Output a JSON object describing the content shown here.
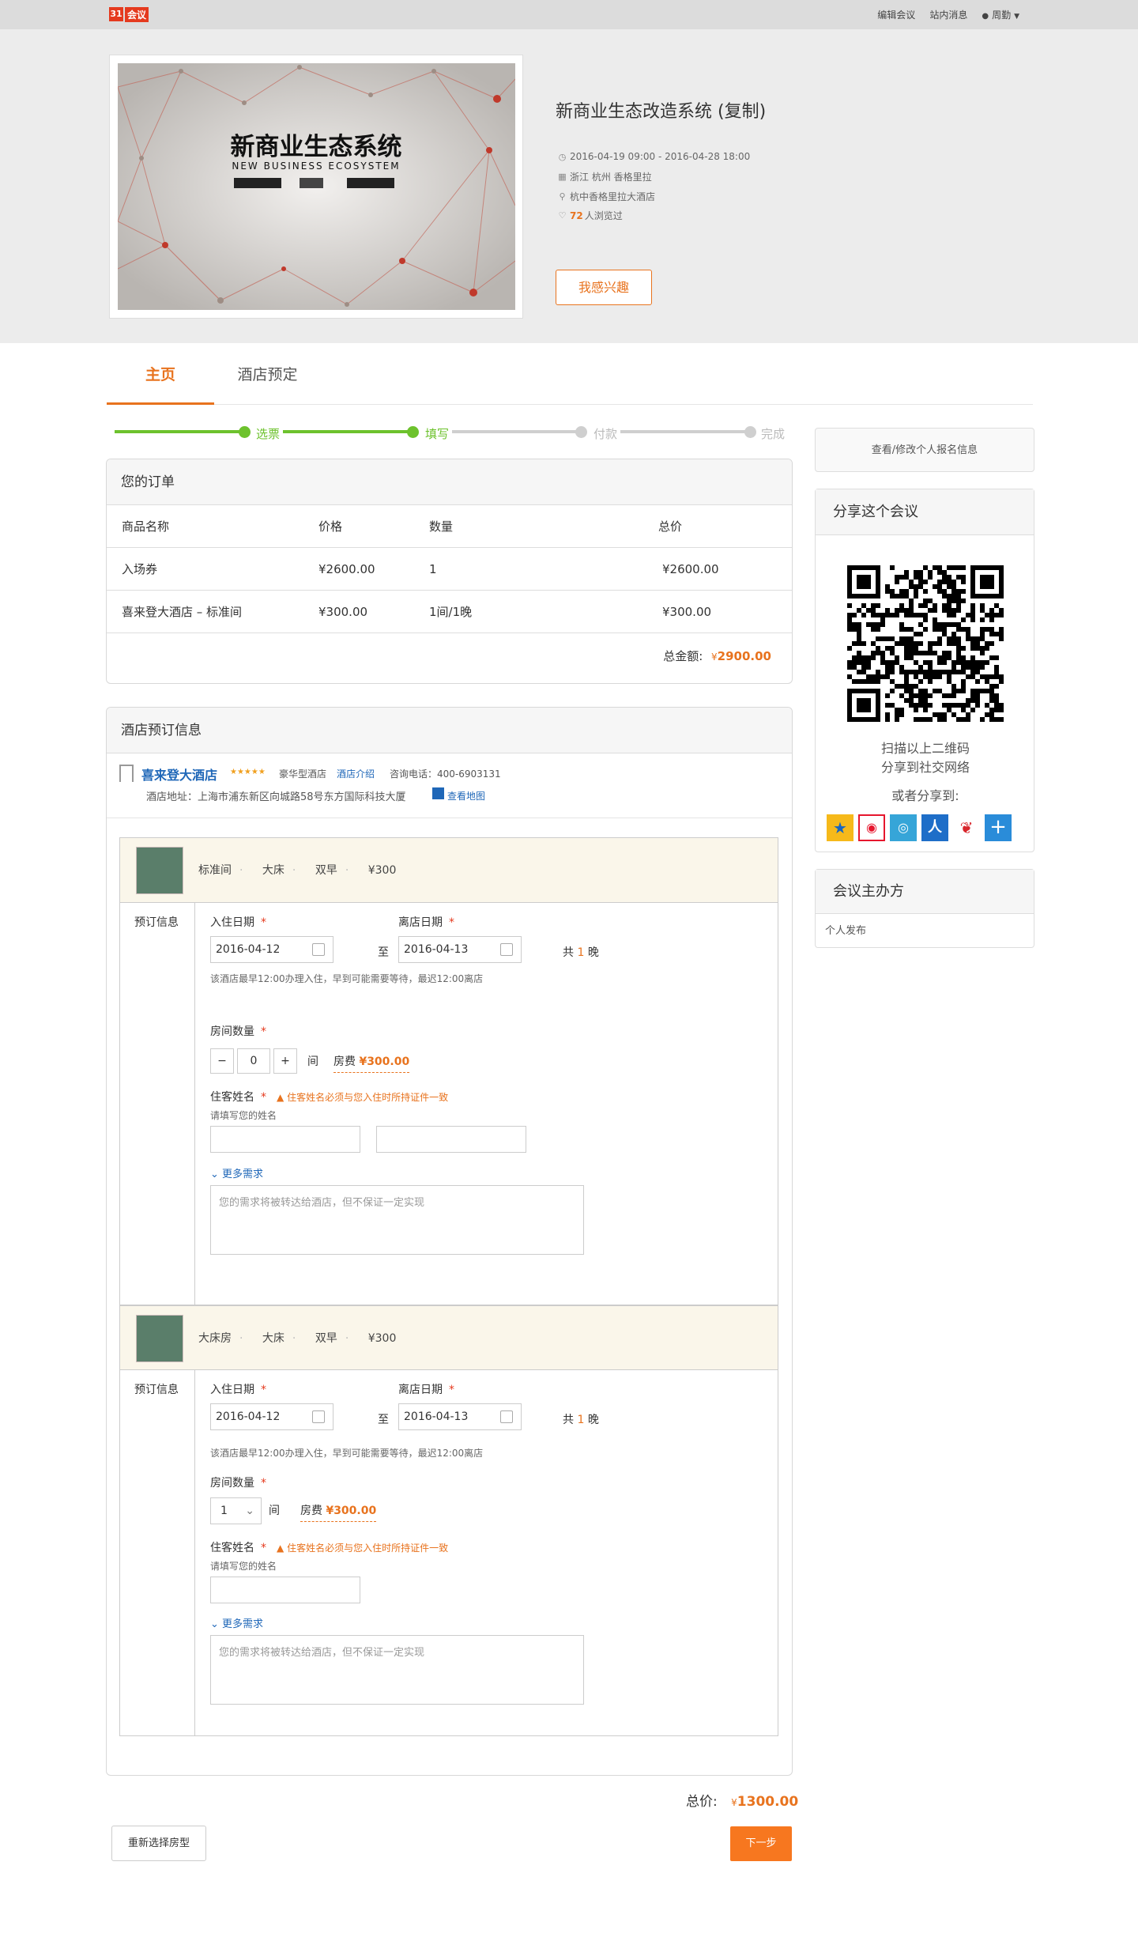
{
  "topbar": {
    "logo_box": "31",
    "logo_text": "会议",
    "nav": [
      "编辑会议",
      "站内消息",
      "周勤"
    ]
  },
  "event": {
    "title": "新商业生态改造系统 (复制)",
    "poster_title": "新商业生态系统",
    "poster_subtitle": "NEW BUSINESS ECOSYSTEM",
    "date": "2016-04-19 09:00 - 2016-04-28 18:00",
    "location": "浙江 杭州 香格里拉",
    "venue": "杭中香格里拉大酒店",
    "views_count": "72",
    "views_suffix": "人浏览过",
    "interest_btn": "我感兴趣"
  },
  "tabs": [
    "主页",
    "酒店预定"
  ],
  "steps": [
    "选票",
    "填写",
    "付款",
    "完成"
  ],
  "colors": {
    "accent": "#e8731e",
    "step_done": "#6dc22d",
    "step_todo": "#cfcfcf"
  },
  "order": {
    "title": "您的订单",
    "headers": [
      "商品名称",
      "价格",
      "数量",
      "总价"
    ],
    "rows": [
      [
        "入场券",
        "¥2600.00",
        "1",
        "¥2600.00"
      ],
      [
        "喜来登大酒店 – 标准间",
        "¥300.00",
        "1间/1晚",
        "¥300.00"
      ]
    ],
    "total_label": "总金额:",
    "total_currency": "¥",
    "total_value": "2900.00"
  },
  "hotel": {
    "title": "酒店预订信息",
    "name": "喜来登大酒店",
    "stars": "★★★★★",
    "type": "豪华型酒店",
    "intro_link": "酒店介绍",
    "phone": "咨询电话：400-6903131",
    "address": "酒店地址：上海市浦东新区向城路58号东方国际科技大厦",
    "map_link": "查看地图"
  },
  "rooms": [
    {
      "desc": [
        "标准间",
        "大床",
        "双早",
        "¥300"
      ],
      "side_label": "预订信息",
      "checkin_label": "入住日期",
      "checkin": "2016-04-12",
      "to": "至",
      "checkout_label": "离店日期",
      "checkout": "2016-04-13",
      "nights_pre": "共",
      "nights": "1",
      "nights_post": "晚",
      "note": "该酒店最早12:00办理入住，早到可能需要等待，最迟12:00离店",
      "qty_label": "房间数量",
      "qty_minus": "−",
      "qty": "0",
      "qty_plus": "+",
      "unit": "间",
      "fee_label": "房费",
      "fee": "¥300.00",
      "guest_label": "住客姓名",
      "warn": "住客姓名必须与您入住时所持证件一致",
      "guest_hint": "请填写您的姓名",
      "more": "更多需求",
      "textarea": "您的需求将被转达给酒店，但不保证一定实现"
    },
    {
      "desc": [
        "大床房",
        "大床",
        "双早",
        "¥300"
      ],
      "side_label": "预订信息",
      "checkin_label": "入住日期",
      "checkin": "2016-04-12",
      "to": "至",
      "checkout_label": "离店日期",
      "checkout": "2016-04-13",
      "nights_pre": "共",
      "nights": "1",
      "nights_post": "晚",
      "note": "该酒店最早12:00办理入住，早到可能需要等待，最迟12:00离店",
      "qty_label": "房间数量",
      "qty": "1",
      "unit": "间",
      "fee_label": "房费",
      "fee": "¥300.00",
      "guest_label": "住客姓名",
      "warn": "住客姓名必须与您入住时所持证件一致",
      "guest_hint": "请填写您的姓名",
      "more": "更多需求",
      "textarea": "您的需求将被转达给酒店，但不保证一定实现"
    }
  ],
  "summary": {
    "label": "总价:",
    "currency": "¥",
    "value": "1300.00"
  },
  "buttons": {
    "reselect": "重新选择房型",
    "next": "下一步"
  },
  "sidebar": {
    "view_btn": "查看/修改个人报名信息",
    "share_title": "分享这个会议",
    "scan_line1": "扫描以上二维码",
    "scan_line2": "分享到社交网络",
    "or_share": "或者分享到:",
    "share_icons": [
      "qzone-icon",
      "weibo-icon",
      "tencent-weibo-icon",
      "renren-icon",
      "kaixin-icon",
      "more-share-icon"
    ],
    "organizer_title": "会议主办方",
    "organizer": "个人发布"
  }
}
